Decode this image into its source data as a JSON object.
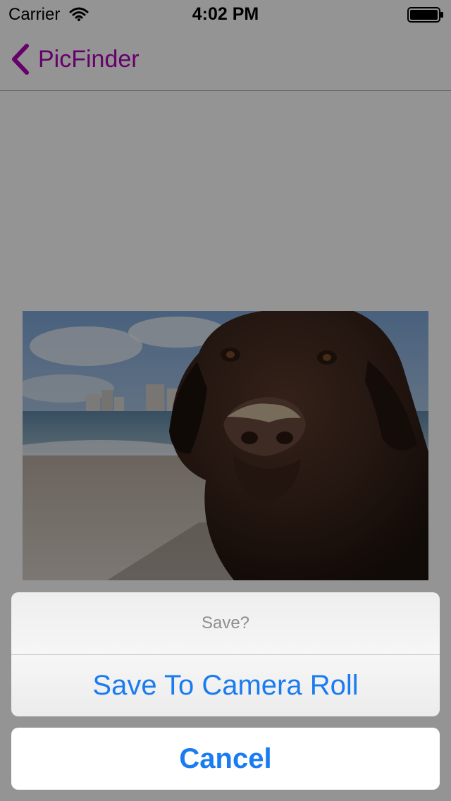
{
  "status_bar": {
    "carrier": "Carrier",
    "time": "4:02 PM",
    "wifi_icon": "wifi-icon",
    "battery_icon": "battery-icon"
  },
  "nav_bar": {
    "back_label": "PicFinder",
    "back_icon": "chevron-left-icon",
    "accent_color": "#b000b8"
  },
  "content": {
    "photo_icon": "dog-photo"
  },
  "action_sheet": {
    "title": "Save?",
    "actions": [
      {
        "label": "Save To Camera Roll"
      }
    ],
    "cancel_label": "Cancel",
    "button_color": "#1a7cf0"
  }
}
